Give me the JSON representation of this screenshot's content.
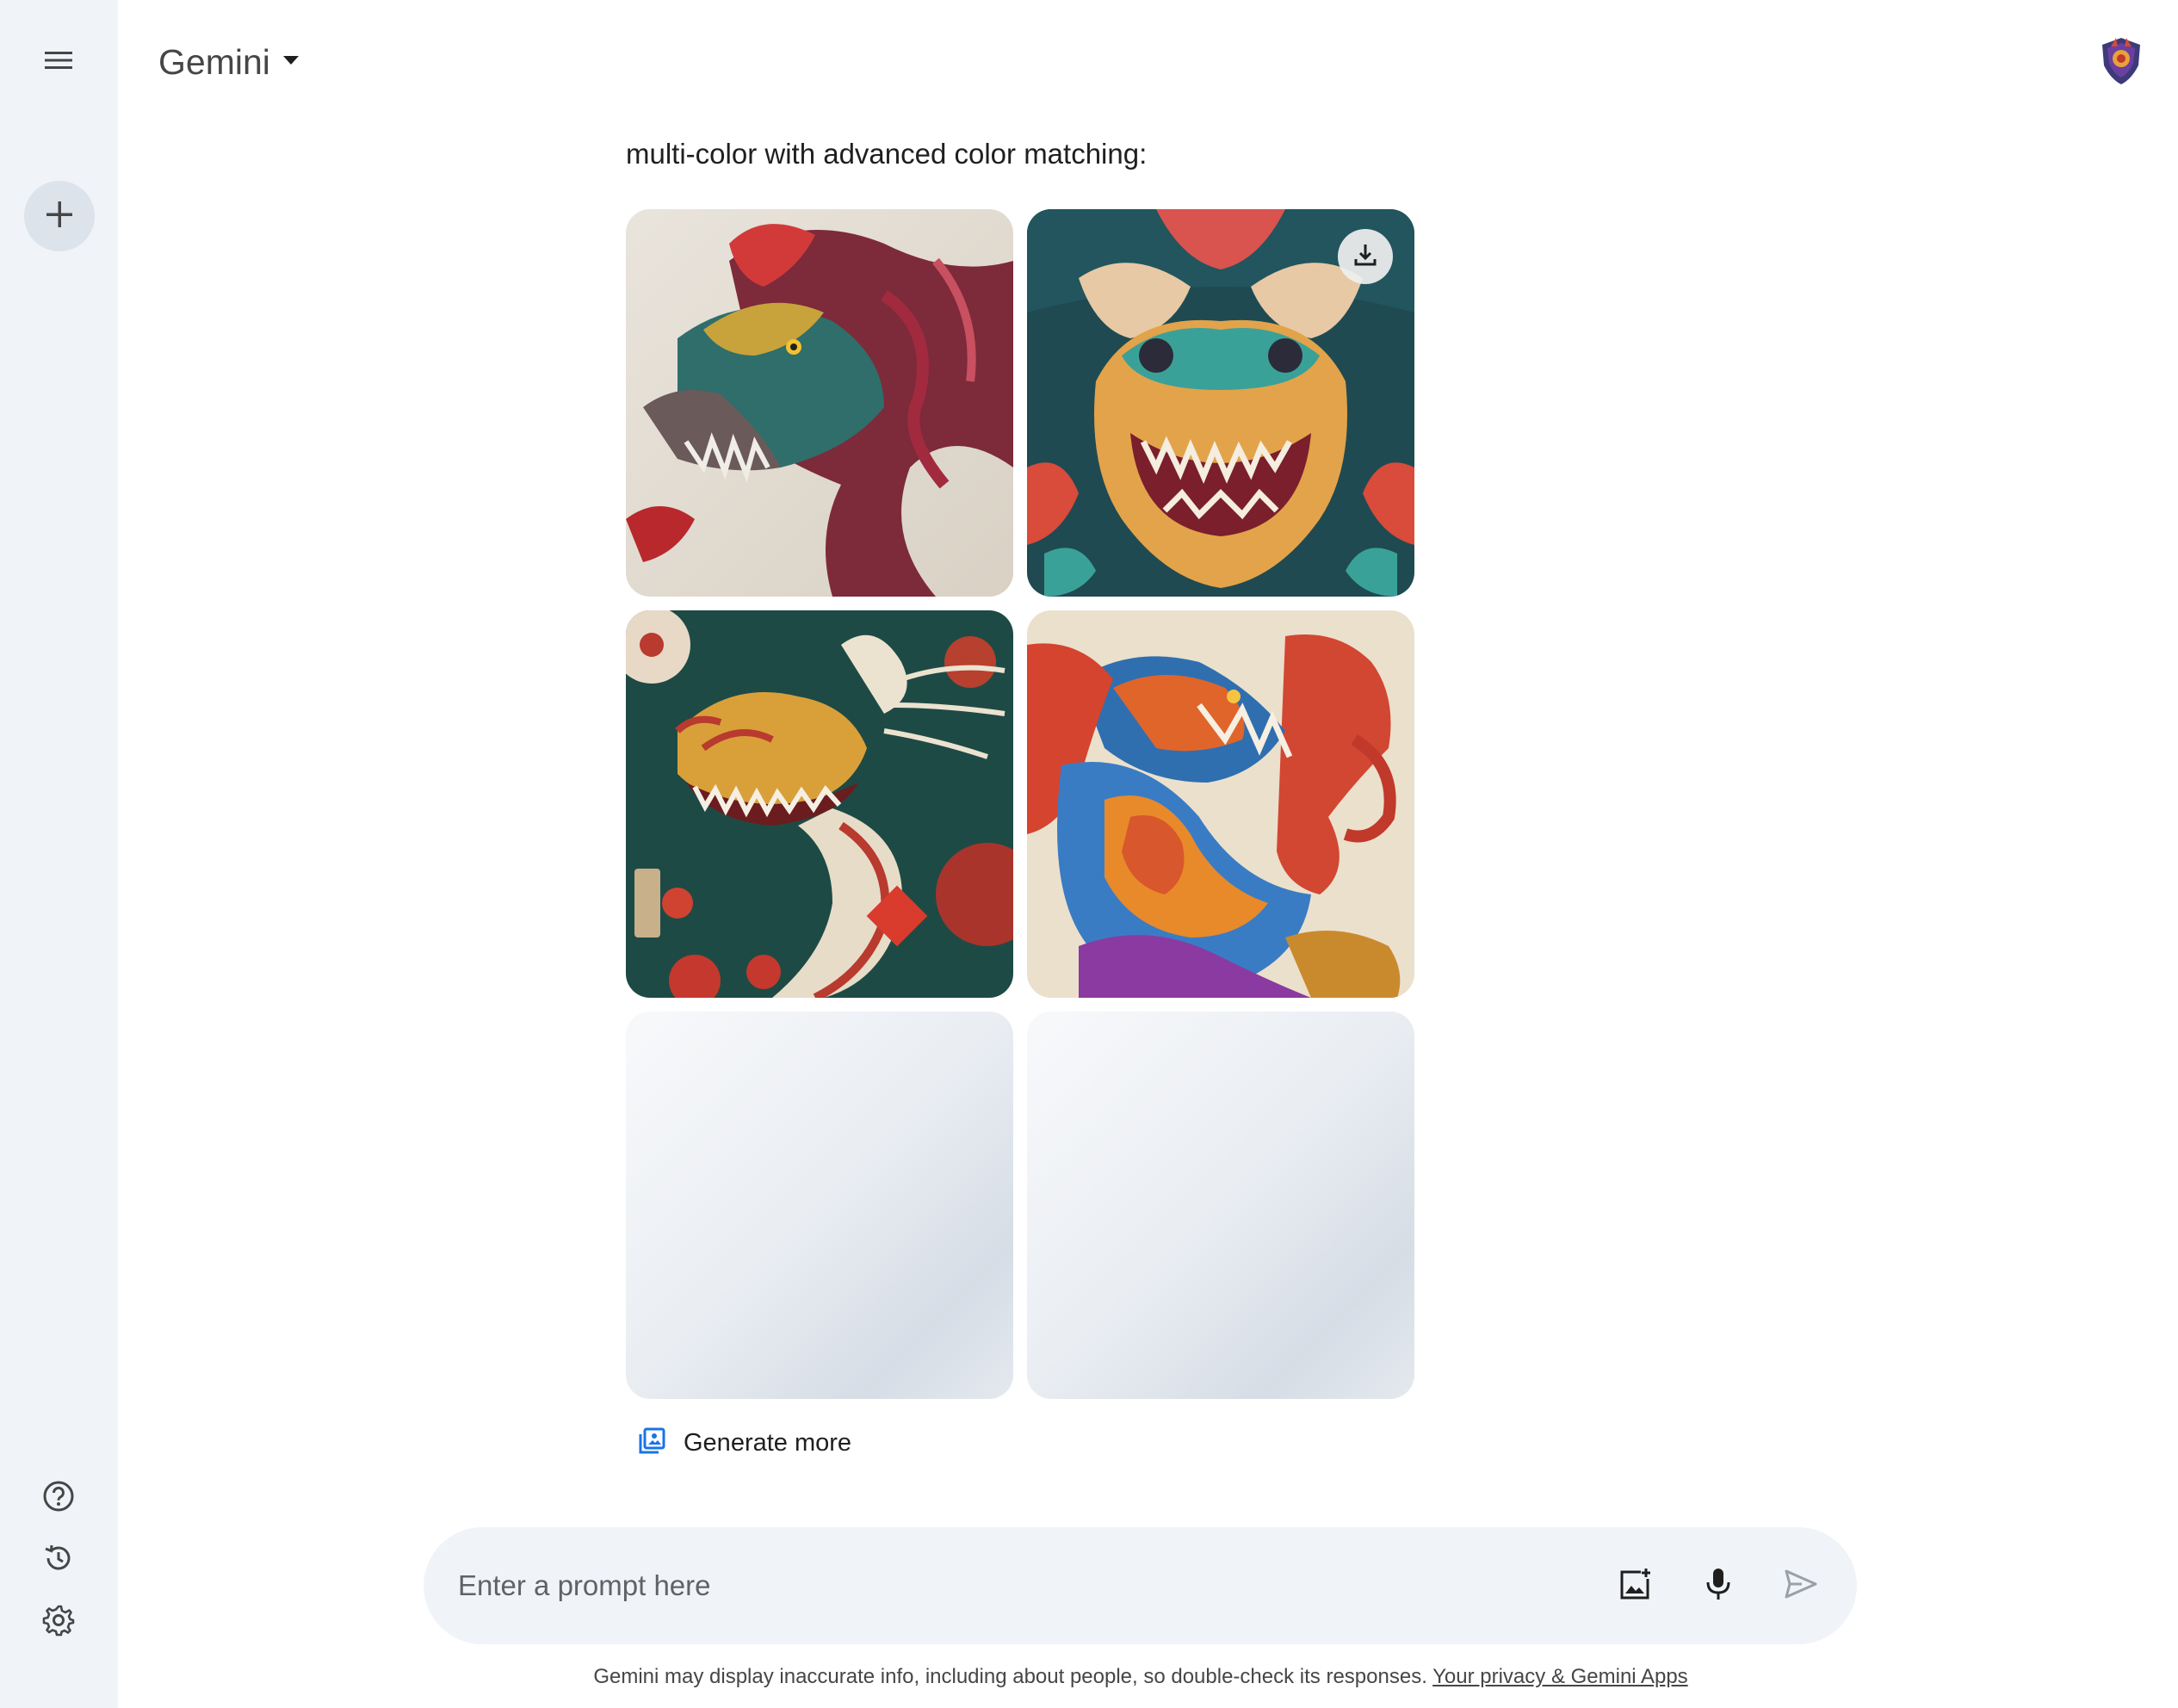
{
  "app": {
    "title": "Gemini"
  },
  "response": {
    "text": "multi-color with advanced color matching:"
  },
  "images": [
    {
      "alt": "Dragon illustration 1"
    },
    {
      "alt": "Dragon illustration 2"
    },
    {
      "alt": "Dragon illustration 3"
    },
    {
      "alt": "Dragon illustration 4"
    }
  ],
  "actions": {
    "generate_more": "Generate more"
  },
  "prompt": {
    "placeholder": "Enter a prompt here"
  },
  "footer": {
    "disclaimer": "Gemini may display inaccurate info, including about people, so double-check its responses.",
    "privacy_link": "Your privacy & Gemini Apps"
  },
  "colors": {
    "rail_bg": "#f0f4f9",
    "prompt_bg": "#f0f4f9",
    "accent": "#1a73e8"
  }
}
